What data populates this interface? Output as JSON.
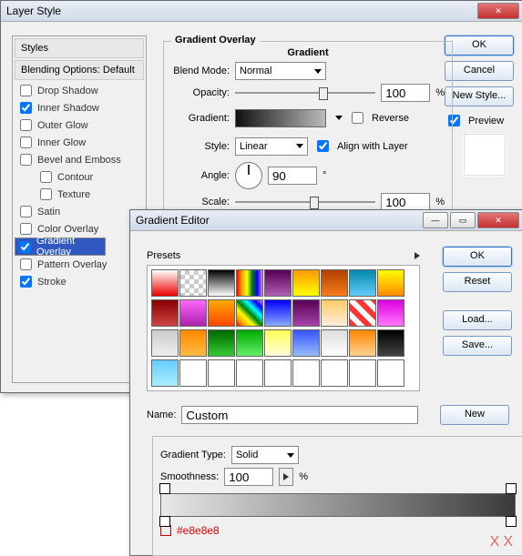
{
  "layerStyle": {
    "title": "Layer Style",
    "stylesHeader": "Styles",
    "blendingHeader": "Blending Options: Default",
    "items": [
      {
        "label": "Drop Shadow",
        "checked": false,
        "indent": false
      },
      {
        "label": "Inner Shadow",
        "checked": true,
        "indent": false
      },
      {
        "label": "Outer Glow",
        "checked": false,
        "indent": false
      },
      {
        "label": "Inner Glow",
        "checked": false,
        "indent": false
      },
      {
        "label": "Bevel and Emboss",
        "checked": false,
        "indent": false
      },
      {
        "label": "Contour",
        "checked": false,
        "indent": true
      },
      {
        "label": "Texture",
        "checked": false,
        "indent": true
      },
      {
        "label": "Satin",
        "checked": false,
        "indent": false
      },
      {
        "label": "Color Overlay",
        "checked": false,
        "indent": false
      },
      {
        "label": "Gradient Overlay",
        "checked": true,
        "indent": false,
        "selected": true
      },
      {
        "label": "Pattern Overlay",
        "checked": false,
        "indent": false
      },
      {
        "label": "Stroke",
        "checked": true,
        "indent": false
      }
    ],
    "buttons": {
      "ok": "OK",
      "cancel": "Cancel",
      "newStyle": "New Style...",
      "preview": "Preview"
    },
    "overlay": {
      "groupTitle": "Gradient Overlay",
      "subTitle": "Gradient",
      "blendModeLbl": "Blend Mode:",
      "blendMode": "Normal",
      "opacityLbl": "Opacity:",
      "opacity": "100",
      "pct": "%",
      "gradientLbl": "Gradient:",
      "reverse": "Reverse",
      "styleLbl": "Style:",
      "style": "Linear",
      "align": "Align with Layer",
      "angleLbl": "Angle:",
      "angle": "90",
      "deg": "°",
      "scaleLbl": "Scale:",
      "scale": "100"
    }
  },
  "gradEditor": {
    "title": "Gradient Editor",
    "presetsLbl": "Presets",
    "buttons": {
      "ok": "OK",
      "reset": "Reset",
      "load": "Load...",
      "save": "Save...",
      "new": "New"
    },
    "nameLbl": "Name:",
    "name": "Custom",
    "typeLbl": "Gradient Type:",
    "type": "Solid",
    "smoothLbl": "Smoothness:",
    "smooth": "100",
    "pct": "%",
    "hex": "#e8e8e8",
    "swatches": [
      "linear-gradient(#fff,#e00)",
      "repeating-conic-gradient(#ccc 0 25%,#fff 0 50%) 0 0/10px 10px",
      "linear-gradient(#000,#fff)",
      "linear-gradient(90deg,red,orange,yellow,green,blue,violet)",
      "linear-gradient(#550055,#b060b0)",
      "linear-gradient(#f90,#ff0)",
      "linear-gradient(#b04000,#f97c1a)",
      "linear-gradient(#08a,#6cf)",
      "linear-gradient(#ff0,#f80)",
      "linear-gradient(#800,#c44)",
      "linear-gradient(#f6f,#a2a)",
      "linear-gradient(#fa0,#f40)",
      "linear-gradient(45deg,red,orange,yellow,green,cyan,blue,violet)",
      "linear-gradient(#00f,#8af)",
      "linear-gradient(#505,#a4a)",
      "linear-gradient(#fc6,#fed)",
      "repeating-linear-gradient(45deg,#f33 0 6px,#fff 6px 12px)",
      "linear-gradient(#d0d,#f7f)",
      "linear-gradient(#ccc,#eee)",
      "linear-gradient(#f80,#fb4)",
      "linear-gradient(#060,#3c3)",
      "linear-gradient(#0a0,#6e6)",
      "linear-gradient(#ff5,#ffd)",
      "linear-gradient(#35f,#9bf)",
      "linear-gradient(#ddd,#fff)",
      "linear-gradient(#f80,#ffd090)",
      "linear-gradient(#000,#444)",
      "linear-gradient(#6cf,#aef)",
      "#fff",
      "#fff",
      "#fff",
      "#fff",
      "#fff",
      "#fff",
      "#fff",
      "#fff"
    ]
  },
  "watermark": "XX"
}
